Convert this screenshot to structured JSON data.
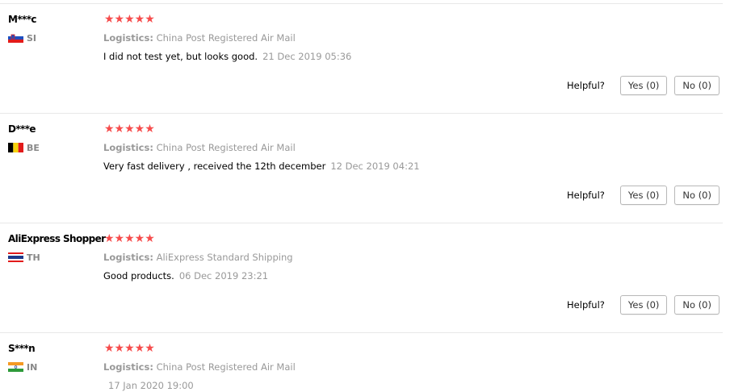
{
  "reviews": [
    {
      "user": "M***c",
      "country_code": "SI",
      "flag": "slovenia-flag",
      "rating": 5,
      "stars": "★★★★★",
      "logistics_label": "Logistics:",
      "logistics_value": "China Post Registered Air Mail",
      "feedback": "I did not test yet, but looks good.",
      "date": "21 Dec 2019 05:36",
      "helpful_label": "Helpful?",
      "yes_label": "Yes (0)",
      "no_label": "No (0)"
    },
    {
      "user": "D***e",
      "country_code": "BE",
      "flag": "belgium-flag",
      "rating": 5,
      "stars": "★★★★★",
      "logistics_label": "Logistics:",
      "logistics_value": "China Post Registered Air Mail",
      "feedback": "Very fast delivery , received the 12th december",
      "date": "12 Dec 2019 04:21",
      "helpful_label": "Helpful?",
      "yes_label": "Yes (0)",
      "no_label": "No (0)"
    },
    {
      "user": "AliExpress Shopper",
      "country_code": "TH",
      "flag": "thailand-flag",
      "rating": 5,
      "stars": "★★★★★",
      "logistics_label": "Logistics:",
      "logistics_value": "AliExpress Standard Shipping",
      "feedback": "Good products.",
      "date": "06 Dec 2019 23:21",
      "helpful_label": "Helpful?",
      "yes_label": "Yes (0)",
      "no_label": "No (0)"
    },
    {
      "user": "S***n",
      "country_code": "IN",
      "flag": "india-flag",
      "rating": 5,
      "stars": "★★★★★",
      "logistics_label": "Logistics:",
      "logistics_value": "China Post Registered Air Mail",
      "feedback": "",
      "date": "17 Jan 2020 19:00"
    }
  ],
  "colors": {
    "star": "#f64c4c",
    "muted_text": "#999999",
    "button_border": "#b8b8b8"
  }
}
